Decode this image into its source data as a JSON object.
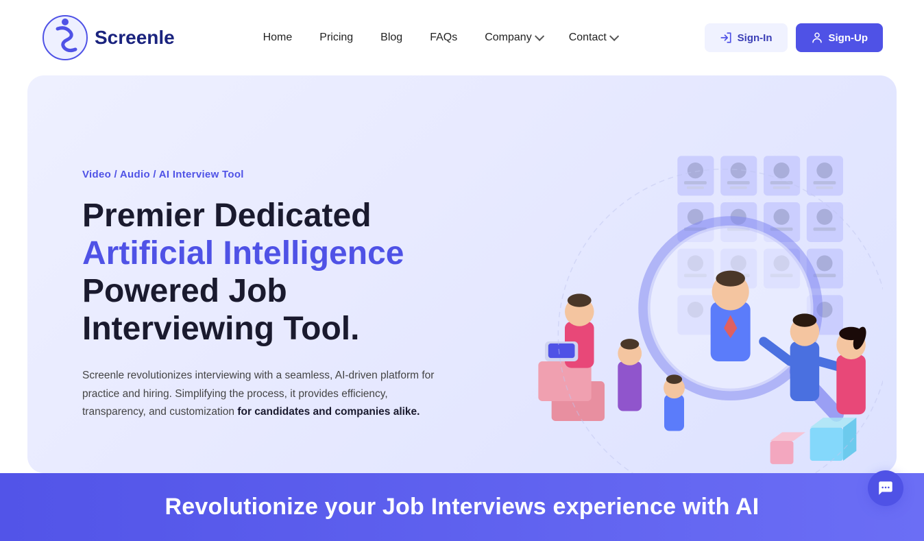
{
  "logo": {
    "text": "Screenle",
    "alt": "Screenle Logo"
  },
  "nav": {
    "links": [
      {
        "label": "Home",
        "id": "home"
      },
      {
        "label": "Pricing",
        "id": "pricing"
      },
      {
        "label": "Blog",
        "id": "blog"
      },
      {
        "label": "FAQs",
        "id": "faqs"
      },
      {
        "label": "Company",
        "id": "company",
        "hasDropdown": true
      },
      {
        "label": "Contact",
        "id": "contact",
        "hasDropdown": true
      }
    ],
    "signin_label": "Sign-In",
    "signup_label": "Sign-Up"
  },
  "hero": {
    "tag": "Video / Audio / AI Interview Tool",
    "title_part1": "Premier Dedicated ",
    "title_highlight": "Artificial Intelligence",
    "title_part2": " Powered Job Interviewing Tool.",
    "description_part1": "Screenle revolutionizes interviewing with a seamless, AI-driven platform for practice and hiring. Simplifying the process, it provides efficiency, transparency, and customization ",
    "description_bold": "for candidates and companies alike.",
    "description_end": ""
  },
  "banner": {
    "text": "Revolutionize your Job Interviews experience with AI"
  },
  "colors": {
    "accent": "#4f52e6",
    "dark": "#1a1a2e",
    "light_bg": "#eef0ff"
  }
}
